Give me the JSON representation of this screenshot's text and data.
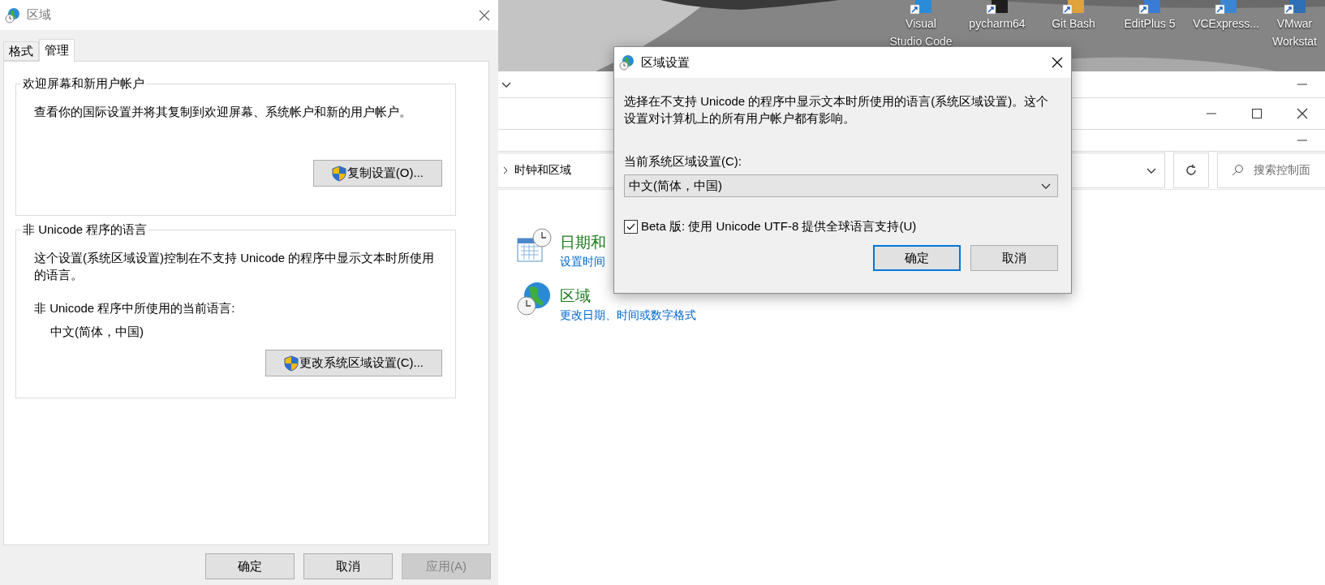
{
  "desktop": {
    "icons": [
      {
        "label": "Visual\nStudio Code"
      },
      {
        "label": "pycharm64"
      },
      {
        "label": "Git Bash"
      },
      {
        "label": "EditPlus 5"
      },
      {
        "label": "VCExpress..."
      },
      {
        "label": "VMwar\nWorkstat"
      }
    ]
  },
  "region_window": {
    "title": "区域",
    "tabs": [
      {
        "label": "格式",
        "selected": false
      },
      {
        "label": "管理",
        "selected": true
      }
    ],
    "groups": [
      {
        "title": "欢迎屏幕和新用户帐户",
        "paragraphs": [
          "查看你的国际设置并将其复制到欢迎屏幕、系统帐户和新的用户帐户。"
        ],
        "button": "复制设置(O)..."
      },
      {
        "title": "非 Unicode 程序的语言",
        "paragraphs": [
          "这个设置(系统区域设置)控制在不支持 Unicode 的程序中显示文本时所使用的语言。",
          "非 Unicode 程序中所使用的当前语言:"
        ],
        "value": "中文(简体，中国)",
        "button": "更改系统区域设置(C)..."
      }
    ],
    "buttons": [
      {
        "label": "确定",
        "disabled": false
      },
      {
        "label": "取消",
        "disabled": false
      },
      {
        "label": "应用(A)",
        "disabled": true
      }
    ]
  },
  "control_panel": {
    "breadcrumb": "时钟和区域",
    "search_placeholder": "搜索控制面",
    "items": [
      {
        "kind": "datetime",
        "title": "日期和",
        "link": "设置时间"
      },
      {
        "kind": "region",
        "title": "区域",
        "link": "更改日期、时间或数字格式"
      }
    ]
  },
  "dialog": {
    "title": "区域设置",
    "description": "选择在不支持 Unicode 的程序中显示文本时所使用的语言(系统区域设置)。这个设置对计算机上的所有用户帐户都有影响。",
    "combo_label": "当前系统区域设置(C):",
    "combo_value": "中文(简体，中国)",
    "checkbox": {
      "label": "Beta 版: 使用 Unicode UTF-8 提供全球语言支持(U)",
      "checked": true
    },
    "buttons": [
      {
        "label": "确定",
        "default": true
      },
      {
        "label": "取消",
        "default": false
      }
    ]
  }
}
